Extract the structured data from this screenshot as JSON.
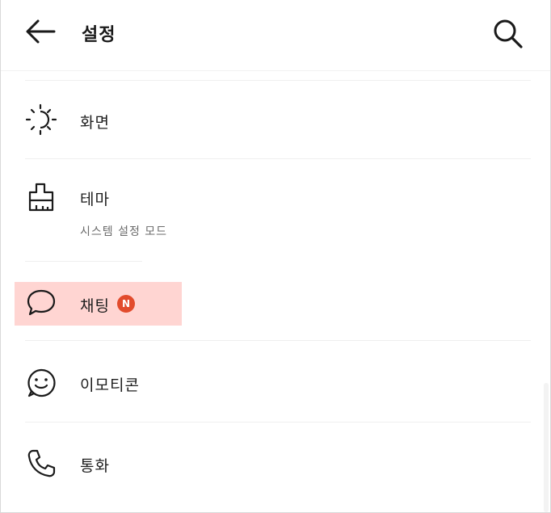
{
  "header": {
    "title": "설정",
    "back_icon": "back-arrow-icon",
    "search_icon": "search-icon"
  },
  "menu": {
    "items": [
      {
        "id": "display",
        "label": "화면",
        "icon": "brightness-icon"
      },
      {
        "id": "theme",
        "label": "테마",
        "sub": "시스템 설정 모드",
        "icon": "brush-icon"
      },
      {
        "id": "chat",
        "label": "채팅",
        "badge": "N",
        "icon": "chat-bubble-icon",
        "highlighted": true
      },
      {
        "id": "emoticon",
        "label": "이모티콘",
        "icon": "smile-icon"
      },
      {
        "id": "call",
        "label": "통화",
        "icon": "phone-icon"
      }
    ]
  },
  "colors": {
    "highlight": "#ffd5d2",
    "badge": "#e24b2c",
    "text": "#1e1e1e",
    "subtext": "#6b6b6b"
  }
}
